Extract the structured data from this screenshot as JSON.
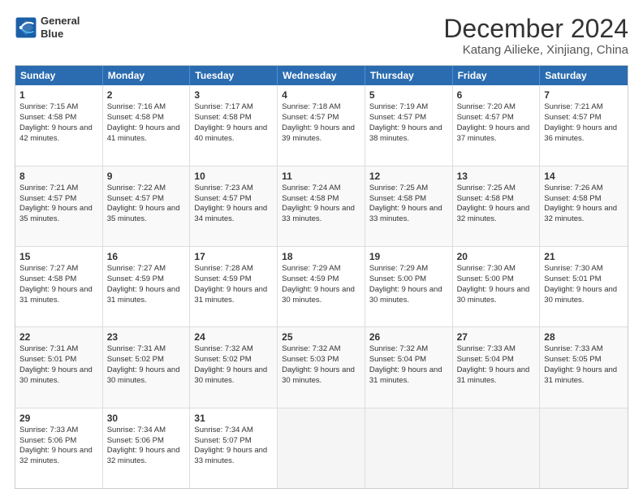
{
  "logo": {
    "line1": "General",
    "line2": "Blue"
  },
  "title": "December 2024",
  "subtitle": "Katang Ailieke, Xinjiang, China",
  "weekdays": [
    "Sunday",
    "Monday",
    "Tuesday",
    "Wednesday",
    "Thursday",
    "Friday",
    "Saturday"
  ],
  "weeks": [
    [
      {
        "day": 1,
        "sunrise": "Sunrise: 7:15 AM",
        "sunset": "Sunset: 4:58 PM",
        "daylight": "Daylight: 9 hours and 42 minutes."
      },
      {
        "day": 2,
        "sunrise": "Sunrise: 7:16 AM",
        "sunset": "Sunset: 4:58 PM",
        "daylight": "Daylight: 9 hours and 41 minutes."
      },
      {
        "day": 3,
        "sunrise": "Sunrise: 7:17 AM",
        "sunset": "Sunset: 4:58 PM",
        "daylight": "Daylight: 9 hours and 40 minutes."
      },
      {
        "day": 4,
        "sunrise": "Sunrise: 7:18 AM",
        "sunset": "Sunset: 4:57 PM",
        "daylight": "Daylight: 9 hours and 39 minutes."
      },
      {
        "day": 5,
        "sunrise": "Sunrise: 7:19 AM",
        "sunset": "Sunset: 4:57 PM",
        "daylight": "Daylight: 9 hours and 38 minutes."
      },
      {
        "day": 6,
        "sunrise": "Sunrise: 7:20 AM",
        "sunset": "Sunset: 4:57 PM",
        "daylight": "Daylight: 9 hours and 37 minutes."
      },
      {
        "day": 7,
        "sunrise": "Sunrise: 7:21 AM",
        "sunset": "Sunset: 4:57 PM",
        "daylight": "Daylight: 9 hours and 36 minutes."
      }
    ],
    [
      {
        "day": 8,
        "sunrise": "Sunrise: 7:21 AM",
        "sunset": "Sunset: 4:57 PM",
        "daylight": "Daylight: 9 hours and 35 minutes."
      },
      {
        "day": 9,
        "sunrise": "Sunrise: 7:22 AM",
        "sunset": "Sunset: 4:57 PM",
        "daylight": "Daylight: 9 hours and 35 minutes."
      },
      {
        "day": 10,
        "sunrise": "Sunrise: 7:23 AM",
        "sunset": "Sunset: 4:57 PM",
        "daylight": "Daylight: 9 hours and 34 minutes."
      },
      {
        "day": 11,
        "sunrise": "Sunrise: 7:24 AM",
        "sunset": "Sunset: 4:58 PM",
        "daylight": "Daylight: 9 hours and 33 minutes."
      },
      {
        "day": 12,
        "sunrise": "Sunrise: 7:25 AM",
        "sunset": "Sunset: 4:58 PM",
        "daylight": "Daylight: 9 hours and 33 minutes."
      },
      {
        "day": 13,
        "sunrise": "Sunrise: 7:25 AM",
        "sunset": "Sunset: 4:58 PM",
        "daylight": "Daylight: 9 hours and 32 minutes."
      },
      {
        "day": 14,
        "sunrise": "Sunrise: 7:26 AM",
        "sunset": "Sunset: 4:58 PM",
        "daylight": "Daylight: 9 hours and 32 minutes."
      }
    ],
    [
      {
        "day": 15,
        "sunrise": "Sunrise: 7:27 AM",
        "sunset": "Sunset: 4:58 PM",
        "daylight": "Daylight: 9 hours and 31 minutes."
      },
      {
        "day": 16,
        "sunrise": "Sunrise: 7:27 AM",
        "sunset": "Sunset: 4:59 PM",
        "daylight": "Daylight: 9 hours and 31 minutes."
      },
      {
        "day": 17,
        "sunrise": "Sunrise: 7:28 AM",
        "sunset": "Sunset: 4:59 PM",
        "daylight": "Daylight: 9 hours and 31 minutes."
      },
      {
        "day": 18,
        "sunrise": "Sunrise: 7:29 AM",
        "sunset": "Sunset: 4:59 PM",
        "daylight": "Daylight: 9 hours and 30 minutes."
      },
      {
        "day": 19,
        "sunrise": "Sunrise: 7:29 AM",
        "sunset": "Sunset: 5:00 PM",
        "daylight": "Daylight: 9 hours and 30 minutes."
      },
      {
        "day": 20,
        "sunrise": "Sunrise: 7:30 AM",
        "sunset": "Sunset: 5:00 PM",
        "daylight": "Daylight: 9 hours and 30 minutes."
      },
      {
        "day": 21,
        "sunrise": "Sunrise: 7:30 AM",
        "sunset": "Sunset: 5:01 PM",
        "daylight": "Daylight: 9 hours and 30 minutes."
      }
    ],
    [
      {
        "day": 22,
        "sunrise": "Sunrise: 7:31 AM",
        "sunset": "Sunset: 5:01 PM",
        "daylight": "Daylight: 9 hours and 30 minutes."
      },
      {
        "day": 23,
        "sunrise": "Sunrise: 7:31 AM",
        "sunset": "Sunset: 5:02 PM",
        "daylight": "Daylight: 9 hours and 30 minutes."
      },
      {
        "day": 24,
        "sunrise": "Sunrise: 7:32 AM",
        "sunset": "Sunset: 5:02 PM",
        "daylight": "Daylight: 9 hours and 30 minutes."
      },
      {
        "day": 25,
        "sunrise": "Sunrise: 7:32 AM",
        "sunset": "Sunset: 5:03 PM",
        "daylight": "Daylight: 9 hours and 30 minutes."
      },
      {
        "day": 26,
        "sunrise": "Sunrise: 7:32 AM",
        "sunset": "Sunset: 5:04 PM",
        "daylight": "Daylight: 9 hours and 31 minutes."
      },
      {
        "day": 27,
        "sunrise": "Sunrise: 7:33 AM",
        "sunset": "Sunset: 5:04 PM",
        "daylight": "Daylight: 9 hours and 31 minutes."
      },
      {
        "day": 28,
        "sunrise": "Sunrise: 7:33 AM",
        "sunset": "Sunset: 5:05 PM",
        "daylight": "Daylight: 9 hours and 31 minutes."
      }
    ],
    [
      {
        "day": 29,
        "sunrise": "Sunrise: 7:33 AM",
        "sunset": "Sunset: 5:06 PM",
        "daylight": "Daylight: 9 hours and 32 minutes."
      },
      {
        "day": 30,
        "sunrise": "Sunrise: 7:34 AM",
        "sunset": "Sunset: 5:06 PM",
        "daylight": "Daylight: 9 hours and 32 minutes."
      },
      {
        "day": 31,
        "sunrise": "Sunrise: 7:34 AM",
        "sunset": "Sunset: 5:07 PM",
        "daylight": "Daylight: 9 hours and 33 minutes."
      },
      null,
      null,
      null,
      null
    ]
  ]
}
